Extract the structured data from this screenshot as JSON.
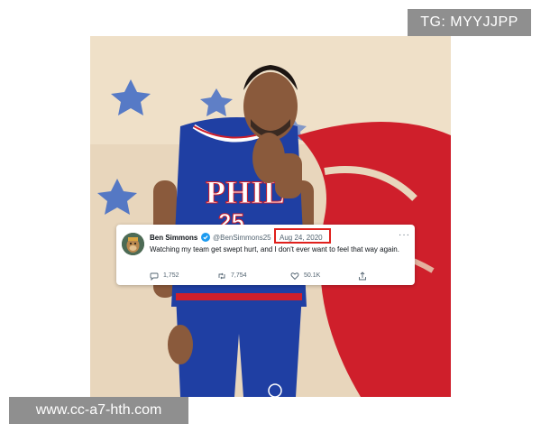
{
  "watermarks": {
    "top_right": "TG: MYYJJPP",
    "bottom_left": "www.cc-a7-hth.com"
  },
  "photo": {
    "jersey_text": "PHIL",
    "jersey_number": "25"
  },
  "tweet": {
    "author_name": "Ben Simmons",
    "handle": "@BenSimmons25",
    "date": "Aug 24, 2020",
    "more_icon": "···",
    "text": "Watching my team get swept hurt, and I don't ever want to feel that way again.",
    "actions": {
      "replies": "1,752",
      "retweets": "7,754",
      "likes": "50.1K"
    }
  },
  "colors": {
    "highlight_box": "#e0201c",
    "verified": "#1d9bf0",
    "jersey_blue": "#1f3fa3",
    "court_red": "#cf1f2b"
  }
}
